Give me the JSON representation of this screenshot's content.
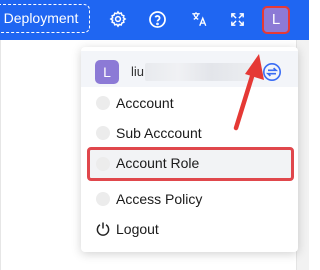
{
  "header": {
    "deploy_label": "Deployment",
    "icons": [
      "gear-icon",
      "help-icon",
      "translate-icon",
      "fullscreen-icon"
    ],
    "avatar_letter": "L",
    "bar_color": "#1f66f2"
  },
  "user_menu": {
    "avatar_letter": "L",
    "username_visible": "liu",
    "username_suffix": "...",
    "items": [
      {
        "label": "Acccount",
        "icon": "dot-icon"
      },
      {
        "label": "Sub Acccount",
        "icon": "dot-icon"
      },
      {
        "label": "Account Role",
        "icon": "dot-icon"
      },
      {
        "label": "Access Policy",
        "icon": "dot-icon"
      },
      {
        "label": "Logout",
        "icon": "power-icon"
      }
    ],
    "highlight_color": "#e0474c",
    "avatar_color": "#8c7ad6"
  }
}
